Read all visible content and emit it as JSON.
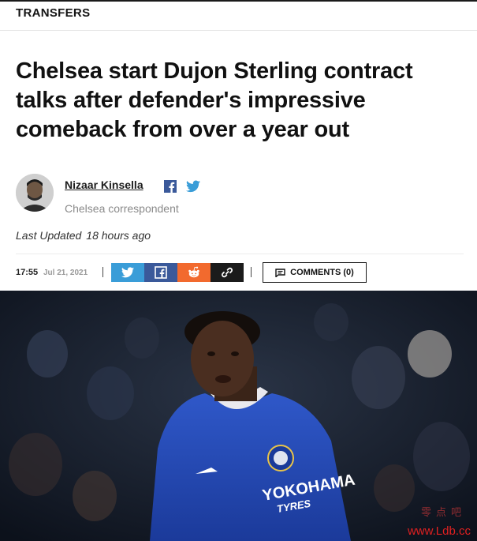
{
  "section": {
    "label": "TRANSFERS"
  },
  "article": {
    "headline": "Chelsea start Dujon Sterling contract talks after defender's impressive comeback from over a year out",
    "author": {
      "name": "Nizaar Kinsella",
      "role": "Chelsea correspondent"
    },
    "updated_label": "Last Updated",
    "updated_value": "18 hours ago",
    "time": "17:55",
    "date": "Jul 21, 2021"
  },
  "share": {
    "buttons": [
      {
        "icon": "twitter-icon",
        "color": "#3a9dd8"
      },
      {
        "icon": "facebook-icon",
        "color": "#3a599a"
      },
      {
        "icon": "reddit-icon",
        "color": "#f26a2e"
      },
      {
        "icon": "link-icon",
        "color": "#1b1b1b"
      }
    ],
    "comments_label": "COMMENTS (0)"
  },
  "image": {
    "kit_sponsor": "YOKOHAMA TYRES"
  },
  "watermark": {
    "url": "www.Ldb.cc"
  }
}
